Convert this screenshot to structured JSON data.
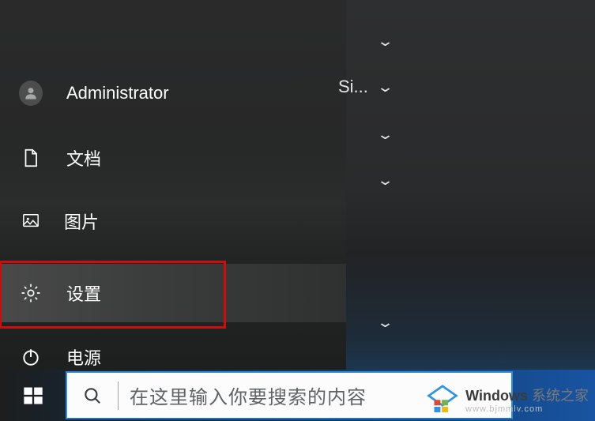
{
  "start_menu": {
    "user_label": "Administrator",
    "items": {
      "documents": "文档",
      "pictures": "图片",
      "settings": "设置",
      "power": "电源"
    },
    "truncated_text": "Si..."
  },
  "taskbar": {
    "search_placeholder": "在这里输入你要搜索的内容"
  },
  "watermark": {
    "brand_bold": "Windows",
    "brand_light": " 系统之家",
    "url": "www.bjmmlv.com"
  }
}
